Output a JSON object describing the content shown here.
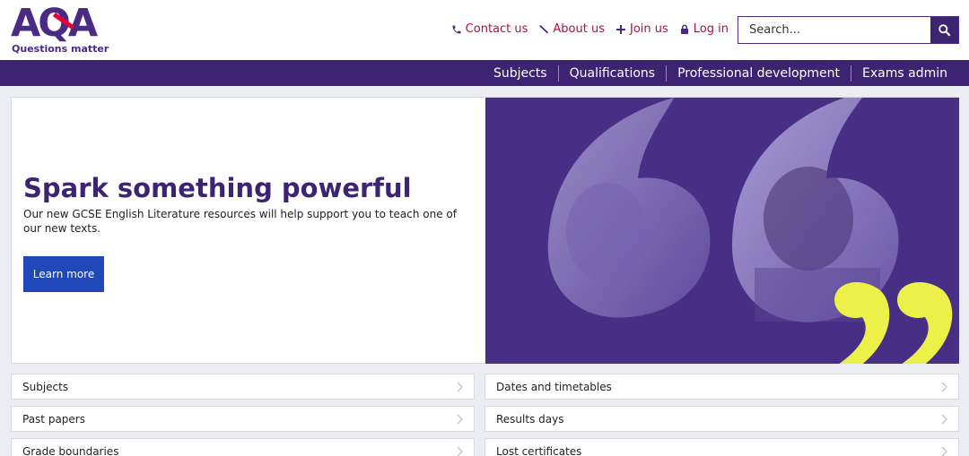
{
  "brand": {
    "logo_text": "AQA",
    "tagline": "Questions matter"
  },
  "utility_nav": [
    {
      "label": "Contact us",
      "icon": "phone-icon"
    },
    {
      "label": "About us",
      "icon": "megaphone-icon"
    },
    {
      "label": "Join us",
      "icon": "plus-icon"
    },
    {
      "label": "Log in",
      "icon": "lock-icon"
    }
  ],
  "search": {
    "placeholder": "Search..."
  },
  "main_nav": [
    "Subjects",
    "Qualifications",
    "Professional development",
    "Exams admin"
  ],
  "hero": {
    "title": "Spark something powerful",
    "description": "Our new GCSE English Literature resources will help support you to teach one of our new texts.",
    "button_label": "Learn more"
  },
  "quick_links": {
    "left": [
      "Subjects",
      "Past papers",
      "Grade boundaries"
    ],
    "right": [
      "Dates and timetables",
      "Results days",
      "Lost certificates"
    ]
  },
  "colors": {
    "brand_purple": "#3d2472",
    "link_red": "#b0103a",
    "button_blue": "#2048b8",
    "quote_yellow": "#eef04a"
  }
}
